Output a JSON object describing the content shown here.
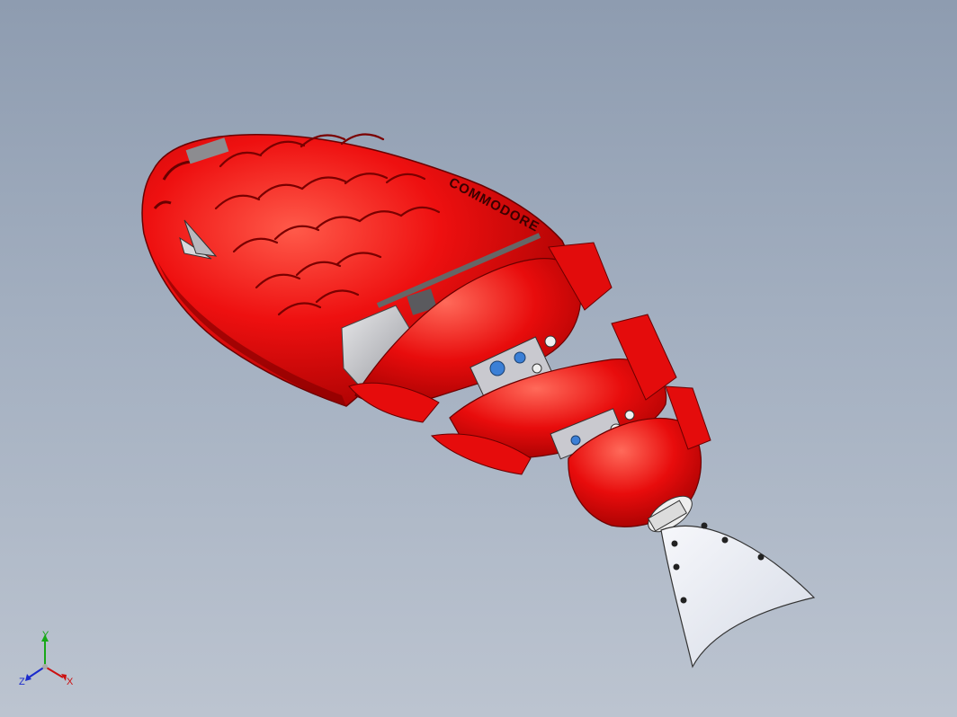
{
  "model": {
    "brand_text": "COMMODORE",
    "body_color": "#e80d0d",
    "fin_color": "#e9edf5"
  },
  "triad": {
    "x_label": "X",
    "y_label": "Y",
    "z_label": "Z",
    "x_color": "#cc1010",
    "y_color": "#18a818",
    "z_color": "#1a2acc"
  }
}
